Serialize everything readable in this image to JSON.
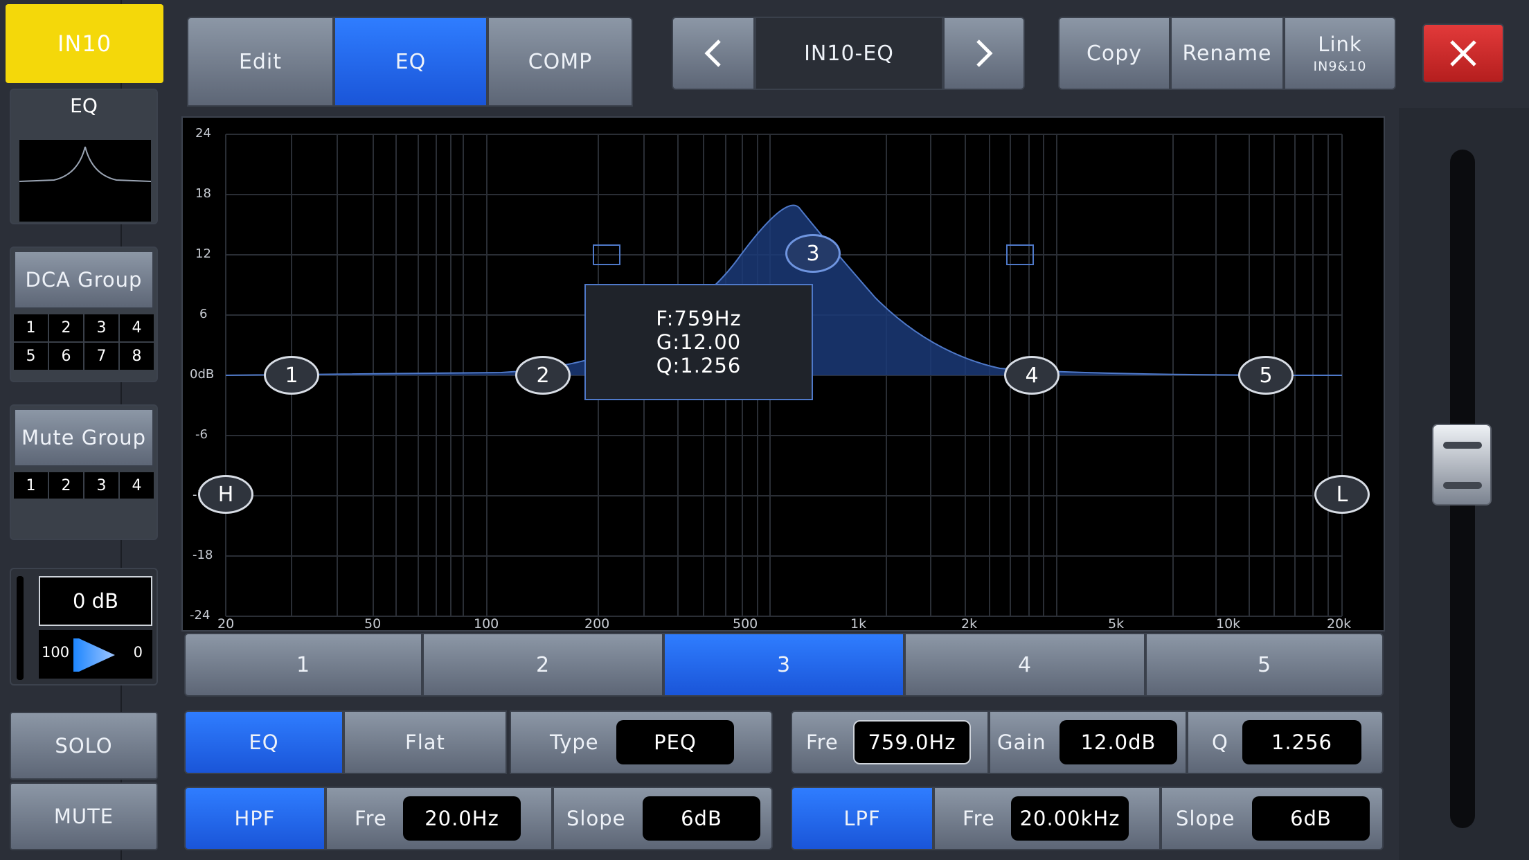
{
  "channel": {
    "name": "IN10"
  },
  "left": {
    "eq_label": "EQ",
    "dca": {
      "label": "DCA Group",
      "cells": [
        "1",
        "2",
        "3",
        "4",
        "5",
        "6",
        "7",
        "8"
      ]
    },
    "mute": {
      "label": "Mute Group",
      "cells": [
        "1",
        "2",
        "3",
        "4"
      ]
    },
    "gain": {
      "value": "0 dB",
      "pan_left": "100",
      "pan_right": "0"
    },
    "solo": "SOLO",
    "mute_button": "MUTE"
  },
  "top": {
    "tabs": [
      "Edit",
      "EQ",
      "COMP"
    ],
    "active_tab": "EQ",
    "preset": "IN10-EQ",
    "copy": "Copy",
    "rename": "Rename",
    "link": "Link",
    "link_sub": "IN9&10"
  },
  "graph": {
    "y_labels": [
      "24",
      "18",
      "12",
      "6",
      "0dB",
      "-6",
      "-12",
      "-18",
      "-24"
    ],
    "x_labels": [
      "20",
      "50",
      "100",
      "200",
      "500",
      "1k",
      "2k",
      "5k",
      "10k",
      "20k"
    ],
    "tooltip": {
      "f": "F:759Hz",
      "g": "G:12.00",
      "q": "Q:1.256"
    },
    "nodes": [
      "1",
      "2",
      "3",
      "4",
      "5"
    ],
    "hpf_node": "H",
    "lpf_node": "L"
  },
  "bands": {
    "items": [
      "1",
      "2",
      "3",
      "4",
      "5"
    ],
    "active": "3"
  },
  "eq_row": {
    "eq": "EQ",
    "flat": "Flat",
    "type_label": "Type",
    "type_value": "PEQ",
    "fre_label": "Fre",
    "fre_value": "759.0Hz",
    "gain_label": "Gain",
    "gain_value": "12.0dB",
    "q_label": "Q",
    "q_value": "1.256"
  },
  "filter_row": {
    "hpf": "HPF",
    "hpf_fre_label": "Fre",
    "hpf_fre_value": "20.0Hz",
    "hpf_slope_label": "Slope",
    "hpf_slope_value": "6dB",
    "lpf": "LPF",
    "lpf_fre_label": "Fre",
    "lpf_fre_value": "20.00kHz",
    "lpf_slope_label": "Slope",
    "lpf_slope_value": "6dB"
  },
  "colors": {
    "accent": "#1d86ff",
    "channel_yellow": "#f4d80a",
    "close_red": "#d62b2b"
  }
}
